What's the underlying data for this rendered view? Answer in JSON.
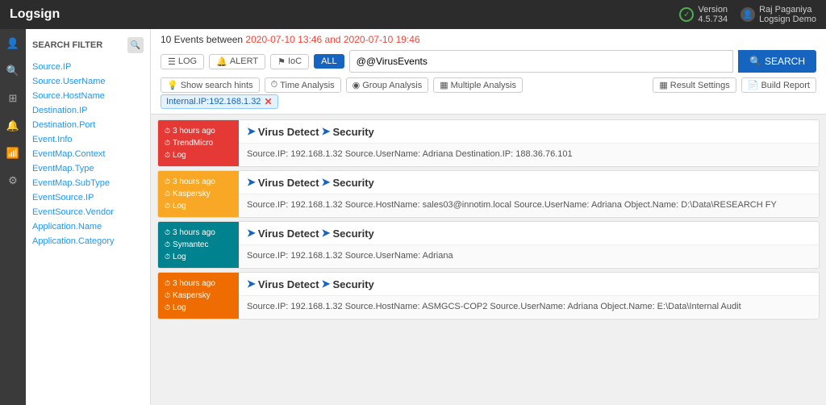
{
  "topbar": {
    "logo": "Logsign",
    "version_label": "Version",
    "version_number": "4.5.734",
    "user_name": "Raj Paganiya",
    "user_org": "Logsign Demo"
  },
  "header": {
    "events_count": "10 Events",
    "events_between": " between ",
    "date_start": "2020-07-10 13:46",
    "date_and": " and ",
    "date_end": "2020-07-10 19:46",
    "search_value": "@@VirusEvents",
    "search_placeholder": "@@VirusEvents",
    "search_btn": "SEARCH",
    "log_btn": "LOG",
    "alert_btn": "ALERT",
    "ioc_btn": "IoC",
    "all_btn": "ALL",
    "show_hints_btn": "Show search hints",
    "time_analysis_btn": "Time Analysis",
    "group_analysis_btn": "Group Analysis",
    "multiple_analysis_btn": "Multiple Analysis",
    "result_settings_btn": "Result Settings",
    "build_report_btn": "Build Report",
    "filter_tag": "Internal.IP:192.168.1.32"
  },
  "sidebar": {
    "title": "SEARCH FILTER",
    "items": [
      {
        "label": "Source.IP"
      },
      {
        "label": "Source.UserName"
      },
      {
        "label": "Source.HostName"
      },
      {
        "label": "Destination.IP"
      },
      {
        "label": "Destination.Port"
      },
      {
        "label": "Event.Info"
      },
      {
        "label": "EventMap.Context"
      },
      {
        "label": "EventMap.Type"
      },
      {
        "label": "EventMap.SubType"
      },
      {
        "label": "EventSource.IP"
      },
      {
        "label": "EventSource.Vendor"
      },
      {
        "label": "Application.Name"
      },
      {
        "label": "Application.Category"
      }
    ]
  },
  "results": [
    {
      "color": "red",
      "time": "3 hours ago",
      "vendor": "TrendMicro",
      "type": "Log",
      "title_part1": "Virus Detect",
      "title_part2": "Security",
      "detail": "Source.IP: 192.168.1.32 Source.UserName: Adriana Destination.IP: 188.36.76.101"
    },
    {
      "color": "yellow",
      "time": "3 hours ago",
      "vendor": "Kaspersky",
      "type": "Log",
      "title_part1": "Virus Detect",
      "title_part2": "Security",
      "detail": "Source.IP: 192.168.1.32 Source.HostName: sales03@innotim.local Source.UserName: Adriana Object.Name: D:\\Data\\RESEARCH FY"
    },
    {
      "color": "teal",
      "time": "3 hours ago",
      "vendor": "Symantec",
      "type": "Log",
      "title_part1": "Virus Detect",
      "title_part2": "Security",
      "detail": "Source.IP: 192.168.1.32 Source.UserName: Adriana"
    },
    {
      "color": "orange",
      "time": "3 hours ago",
      "vendor": "Kaspersky",
      "type": "Log",
      "title_part1": "Virus Detect",
      "title_part2": "Security",
      "detail": "Source.IP: 192.168.1.32 Source.HostName: ASMGCS-COP2 Source.UserName: Adriana Object.Name: E:\\Data\\Internal Audit"
    }
  ],
  "nav_icons": [
    "person",
    "search",
    "grid",
    "bell",
    "wifi",
    "gear"
  ]
}
